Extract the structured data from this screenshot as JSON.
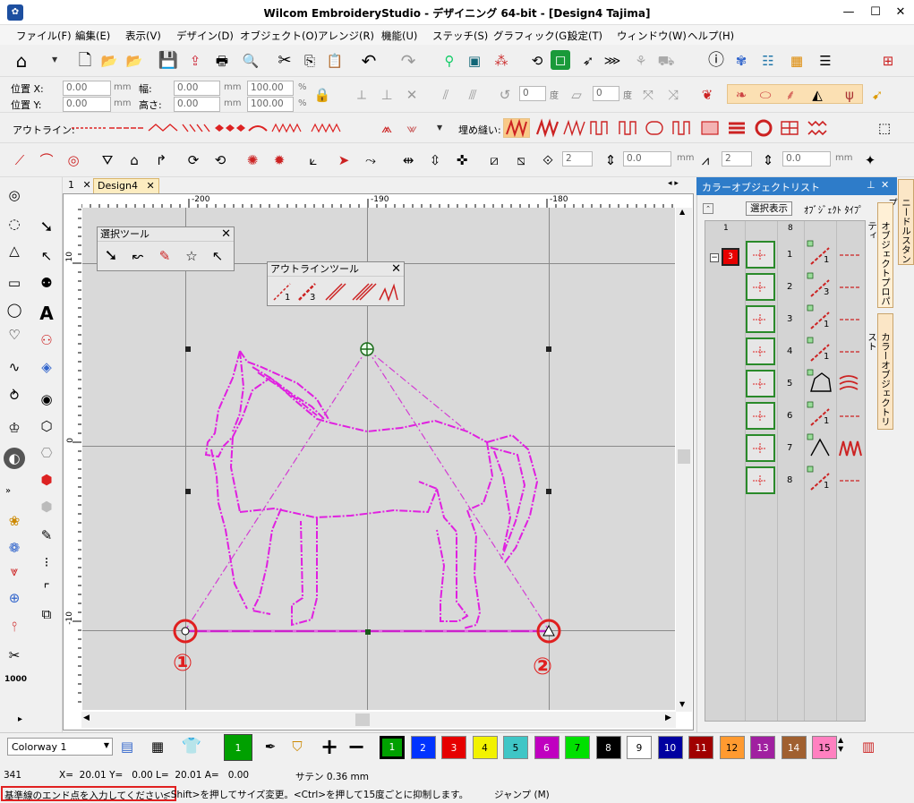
{
  "window": {
    "title": "Wilcom EmbroideryStudio - デザイニング 64-bit - [Design4     Tajima]",
    "minimize": "—",
    "maximize": "☐",
    "close": "✕"
  },
  "menu": [
    "ファイル(F)",
    "編集(E)",
    "表示(V)",
    "デザイン(D)",
    "オブジェクト(O)",
    "アレンジ(R)",
    "機能(U)",
    "ステッチ(S)",
    "グラフィック(G)",
    "設定(T)",
    "ウィンドウ(W)",
    "ヘルプ(H)"
  ],
  "position": {
    "x_label": "位置 X:",
    "y_label": "位置 Y:",
    "x_value": "0.00",
    "y_value": "0.00",
    "w_label": "幅:",
    "h_label": "高さ:",
    "w_value": "0.00",
    "h_value": "0.00",
    "unit": "mm",
    "w_pct": "100.00",
    "h_pct": "100.00",
    "pct": "%",
    "angle1": "0",
    "angle2": "0",
    "deg": "度"
  },
  "outline_row": {
    "outline_label": "アウトライン:",
    "fill_label": "埋め縫い:"
  },
  "tools_row": {
    "spin1": "2",
    "spin2": "0.0",
    "spin3": "2",
    "spin4": "0.0",
    "unit": "mm"
  },
  "tabs": [
    "1",
    "Design4"
  ],
  "ruler": {
    "top": [
      "-200",
      "-190",
      "-180"
    ],
    "left": [
      "10",
      "0",
      "-10"
    ]
  },
  "select_tool": {
    "title": "選択ツール",
    "close": "✕"
  },
  "outline_tool": {
    "title": "アウトラインツール",
    "close": "✕"
  },
  "markers": {
    "m1": "①",
    "m2": "②"
  },
  "color_object_list": {
    "title": "カラーオブジェクトリスト",
    "pin": "⊥",
    "close": "✕",
    "show_select": "選択表示",
    "object_type": "ｵﾌﾞｼﾞｪｸﾄ ﾀｲﾌﾟ",
    "col1": "1",
    "col2": "8",
    "group_color": "3",
    "rows": [
      {
        "num": "1",
        "sub": "1"
      },
      {
        "num": "2",
        "sub": "3"
      },
      {
        "num": "3",
        "sub": "1"
      },
      {
        "num": "4",
        "sub": "1"
      },
      {
        "num": "5",
        "sub": ""
      },
      {
        "num": "6",
        "sub": "1"
      },
      {
        "num": "7",
        "sub": ""
      },
      {
        "num": "8",
        "sub": "1"
      }
    ]
  },
  "side_tabs": {
    "needle_stamp": "ニードルスタンプ",
    "object_props": "オブジェクトプロパティ",
    "color_list": "カラーオブジェクトリスト"
  },
  "colorway": {
    "label": "Colorway 1",
    "current": "1"
  },
  "palette": [
    {
      "n": "1",
      "color": "#00a000"
    },
    {
      "n": "2",
      "color": "#0033ff"
    },
    {
      "n": "3",
      "color": "#e60000"
    },
    {
      "n": "4",
      "color": "#f2f200"
    },
    {
      "n": "5",
      "color": "#3fc6c6"
    },
    {
      "n": "6",
      "color": "#c000c0"
    },
    {
      "n": "7",
      "color": "#00e000"
    },
    {
      "n": "8",
      "color": "#000000"
    },
    {
      "n": "9",
      "color": "#ffffff"
    },
    {
      "n": "10",
      "color": "#0000a0"
    },
    {
      "n": "11",
      "color": "#a00000"
    },
    {
      "n": "12",
      "color": "#ff9a30"
    },
    {
      "n": "13",
      "color": "#a020a0"
    },
    {
      "n": "14",
      "color": "#a06030"
    },
    {
      "n": "15",
      "color": "#ff80c0"
    }
  ],
  "status": {
    "count": "341",
    "coords": "X=  20.01 Y=   0.00 L=  20.01 A=   0.00",
    "stitch": "サテン  0.36 mm",
    "prompt": "基準線のエンド点を入力してください。",
    "hint": "<Shift>を押してサイズ変更。<Ctrl>を押して15度ごとに抑制します。",
    "jump": "ジャンプ (M)"
  }
}
